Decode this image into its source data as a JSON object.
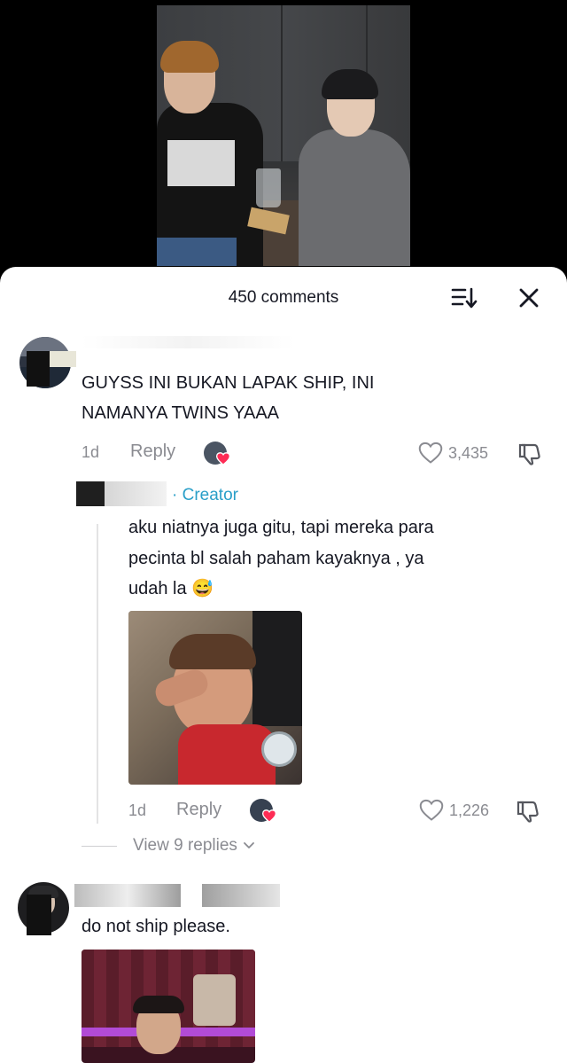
{
  "sheet": {
    "comment_count": "450 comments"
  },
  "comments": [
    {
      "text_line1": "GUYSS INI BUKAN LAPAK SHIP, INI",
      "text_line2": "NAMANYA TWINS YAAA",
      "time": "1d",
      "reply_label": "Reply",
      "likes": "3,435"
    },
    {
      "creator_label": "· Creator",
      "text_line1": "aku niatnya juga gitu, tapi mereka para",
      "text_line2": "pecinta bl salah paham kayaknya , ya",
      "text_line3": "udah la",
      "emoji": "😅",
      "time": "1d",
      "reply_label": "Reply",
      "likes": "1,226",
      "view_replies": "View 9 replies"
    },
    {
      "text_line1": "do not ship please."
    }
  ],
  "icons": {
    "sort": "sort-icon",
    "close": "close-icon",
    "heart": "heart-outline-icon",
    "dislike": "thumbs-down-icon",
    "chevron": "chevron-down-icon"
  },
  "colors": {
    "creator": "#2a9fc8",
    "muted": "#8a8b91",
    "like_heart": "#fe2c55"
  }
}
